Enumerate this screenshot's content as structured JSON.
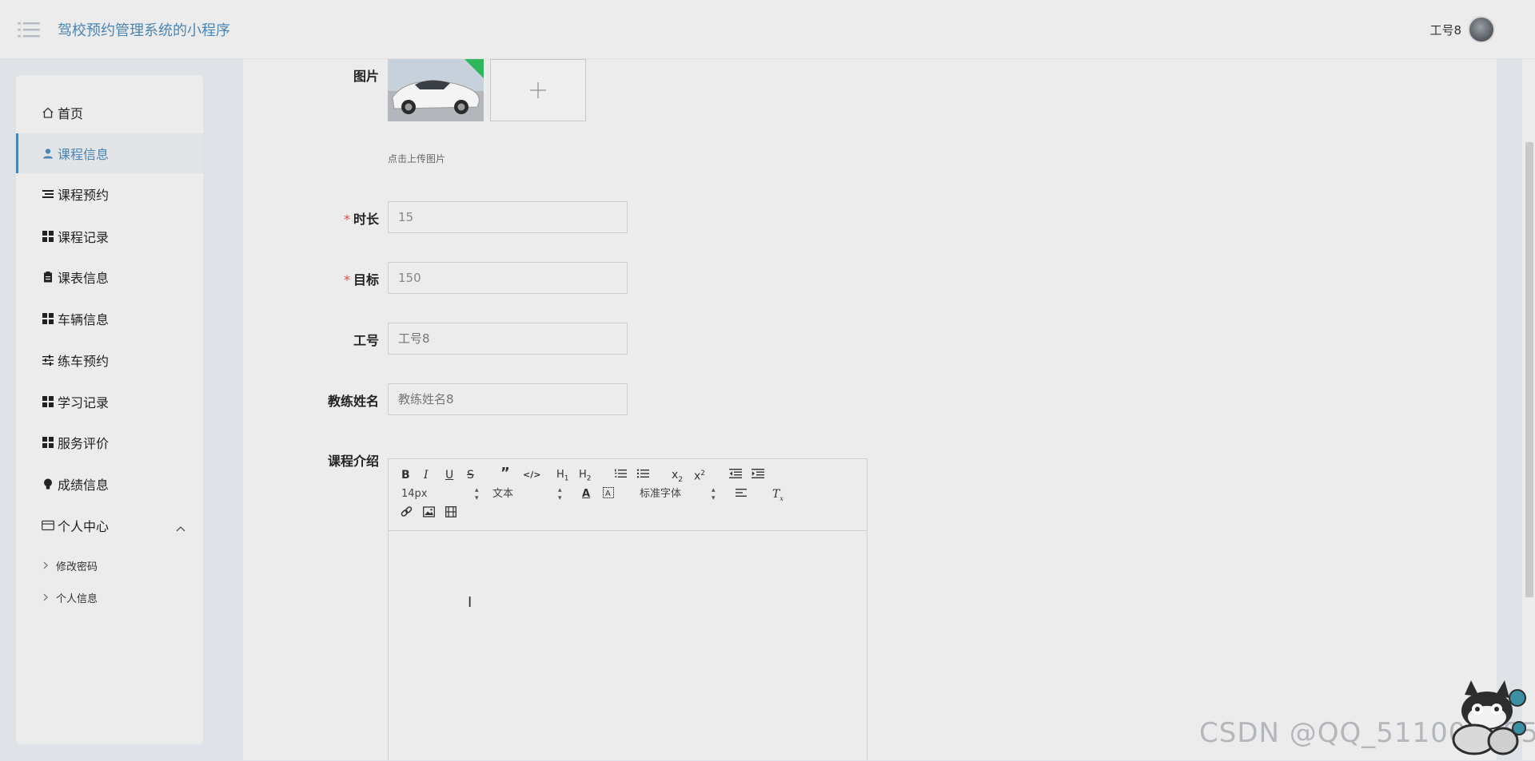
{
  "header": {
    "title": "驾校预约管理系统的小程序",
    "user_name": "工号8"
  },
  "sidebar": {
    "items": [
      {
        "label": "首页",
        "icon": "home-icon"
      },
      {
        "label": "课程信息",
        "icon": "user-icon",
        "active": true
      },
      {
        "label": "课程预约",
        "icon": "list-icon"
      },
      {
        "label": "课程记录",
        "icon": "grid-icon"
      },
      {
        "label": "课表信息",
        "icon": "clipboard-icon"
      },
      {
        "label": "车辆信息",
        "icon": "grid-icon"
      },
      {
        "label": "练车预约",
        "icon": "sliders-icon"
      },
      {
        "label": "学习记录",
        "icon": "grid-icon"
      },
      {
        "label": "服务评价",
        "icon": "grid-icon"
      },
      {
        "label": "成绩信息",
        "icon": "bulb-icon"
      },
      {
        "label": "个人中心",
        "icon": "card-icon"
      }
    ],
    "sub_items": [
      {
        "label": "修改密码"
      },
      {
        "label": "个人信息"
      }
    ]
  },
  "form": {
    "image_label": "图片",
    "upload_tip": "点击上传图片",
    "duration_label": "时长",
    "duration_value": "15",
    "target_label": "目标",
    "target_value": "150",
    "job_no_label": "工号",
    "job_no_placeholder": "工号8",
    "coach_label": "教练姓名",
    "coach_placeholder": "教练姓名8",
    "intro_label": "课程介绍",
    "required_mark": "*"
  },
  "editor": {
    "font_size": "14px",
    "block_type": "文本",
    "font_family": "标准字体"
  },
  "watermark": "CSDN @QQ_511008285",
  "colors": {
    "accent": "#4a86b5",
    "required": "#e04a4a",
    "panel": "#ececec"
  }
}
